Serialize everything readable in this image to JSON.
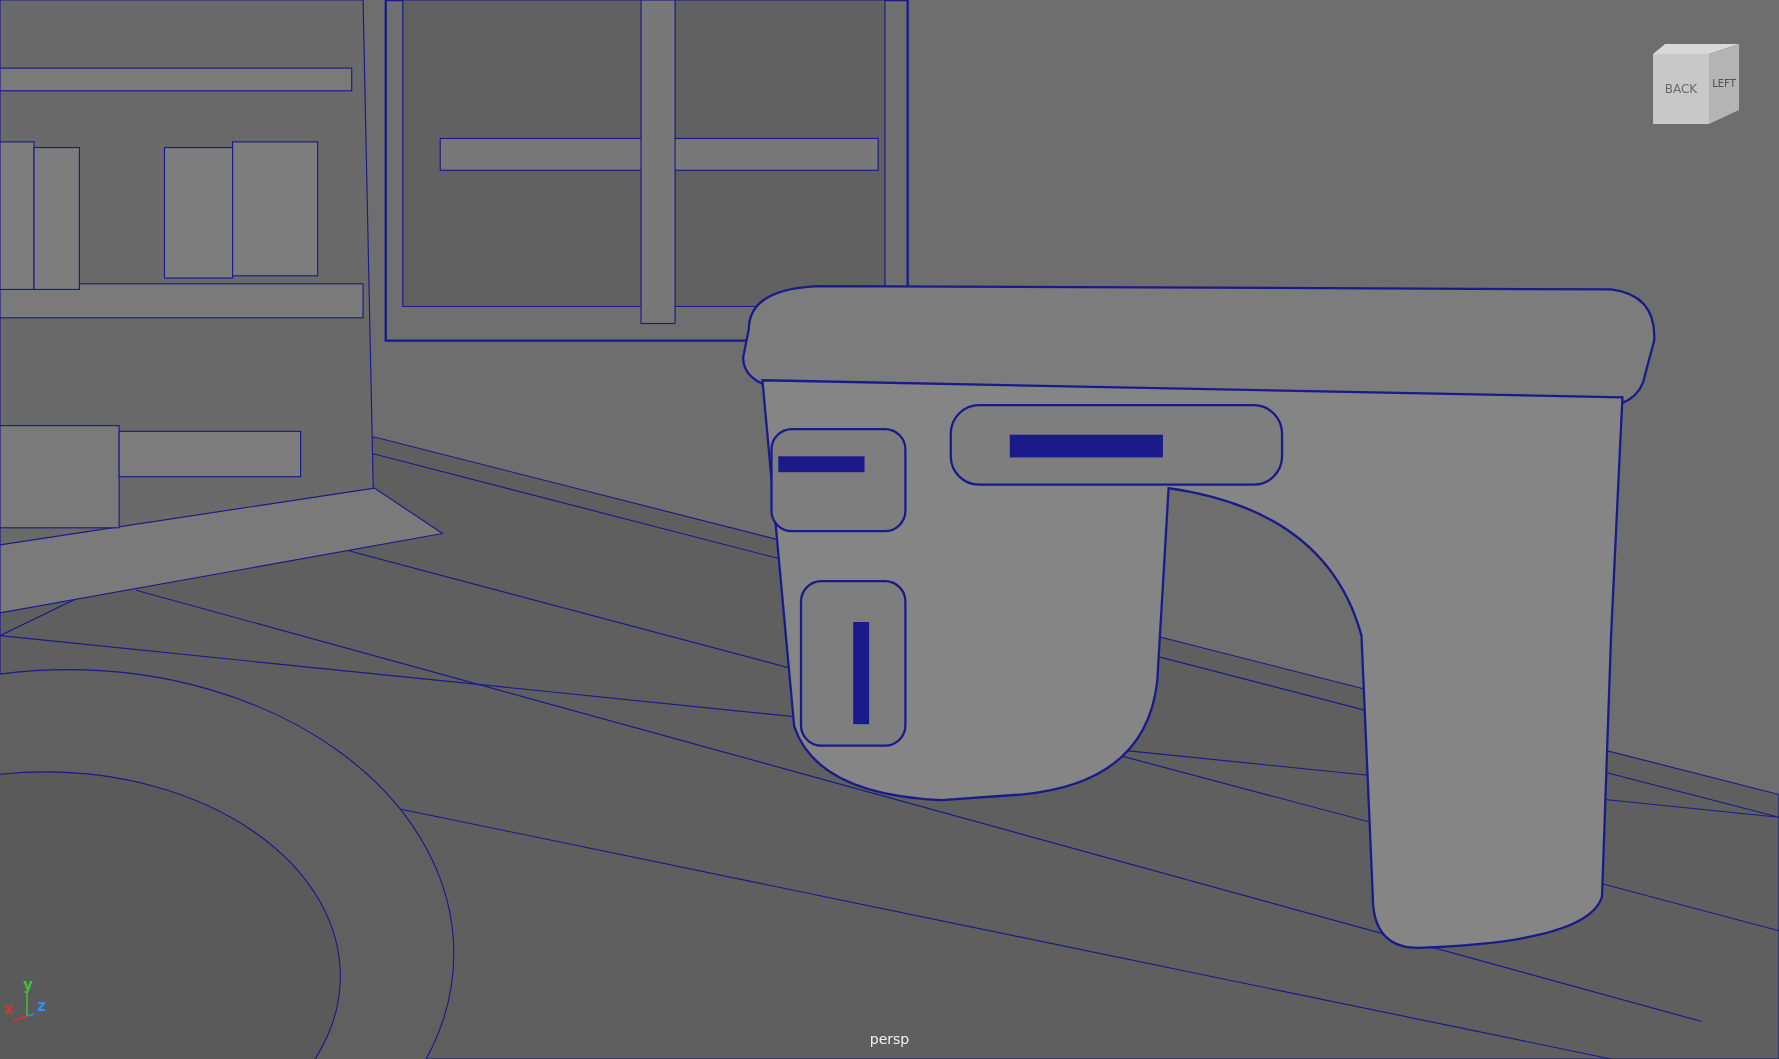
{
  "viewport": {
    "camera_label": "persp"
  },
  "view_cube": {
    "faces": [
      {
        "label": "BACK"
      },
      {
        "label": "LEFT"
      }
    ]
  },
  "axis_gizmo": {
    "labels": [
      {
        "label": "x",
        "color": "#e03030"
      },
      {
        "label": "y",
        "color": "#40c040"
      },
      {
        "label": "z",
        "color": "#3090f0"
      }
    ]
  }
}
